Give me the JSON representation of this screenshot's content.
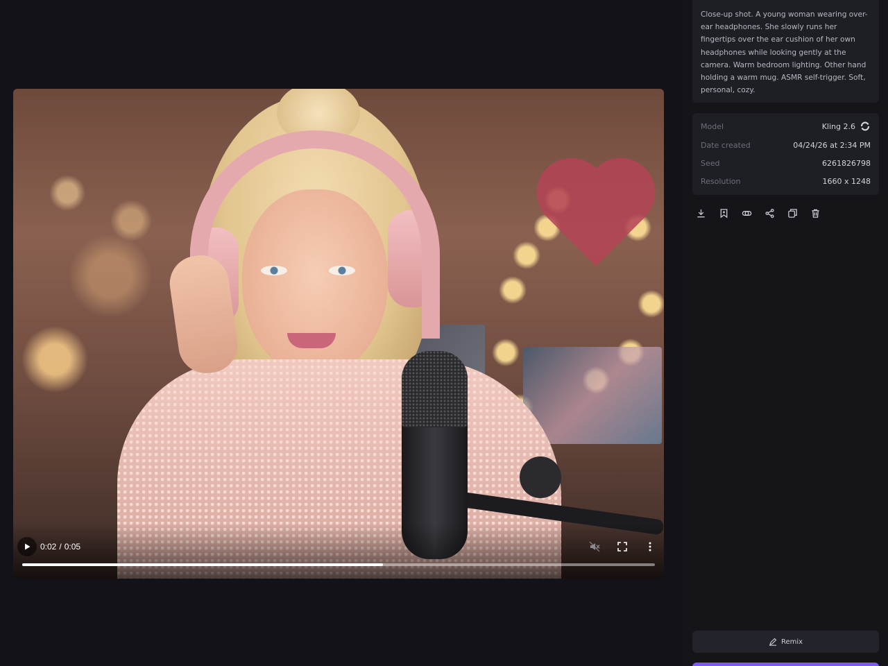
{
  "player": {
    "current_time": "0:02",
    "time_separator": "/",
    "duration": "0:05",
    "progress": 0.57,
    "muted": true
  },
  "prompt": {
    "text": "Close-up shot. A young woman wearing over-ear headphones. She slowly runs her fingertips over the ear cushion of her own headphones while looking gently at the camera. Warm bedroom lighting. Other hand holding a warm mug. ASMR self-trigger. Soft, personal, cozy."
  },
  "meta": {
    "model_label": "Model",
    "model_value": "Kling 2.6",
    "date_label": "Date created",
    "date_value": "04/24/26 at 2:34 PM",
    "seed_label": "Seed",
    "seed_value": "6261826798",
    "resolution_label": "Resolution",
    "resolution_value": "1660 x 1248"
  },
  "actions": [
    "download-icon",
    "bookmark-icon",
    "link-icon",
    "share-icon",
    "duplicate-icon",
    "trash-icon"
  ],
  "remix": {
    "label": "Remix"
  },
  "colors": {
    "background": "#121218",
    "sidebar": "#141419",
    "card": "#1e1e25",
    "accent": "#7c5cf0"
  }
}
